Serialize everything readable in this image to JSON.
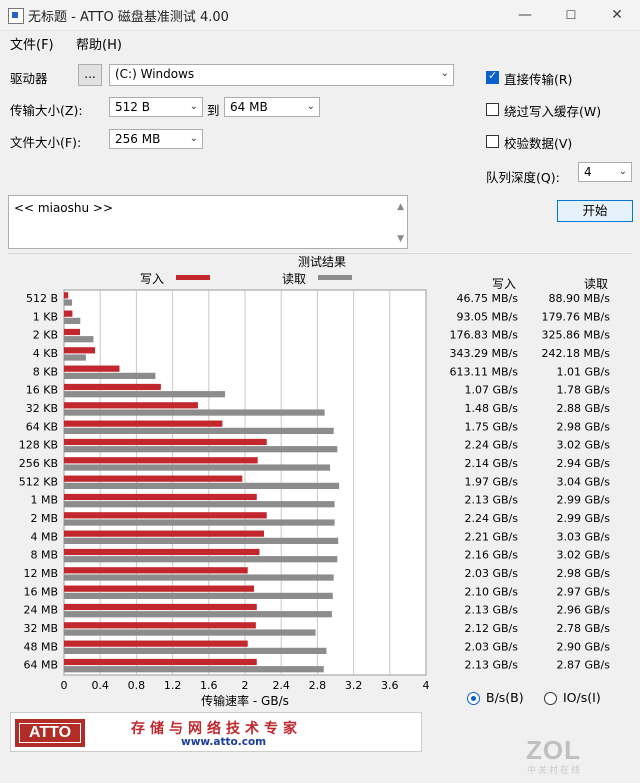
{
  "window": {
    "title": "无标题 - ATTO 磁盘基准测试 4.00",
    "minimize": "—",
    "maximize": "☐",
    "close": "✕"
  },
  "menu": {
    "file": "文件(F)",
    "help": "帮助(H)"
  },
  "settings": {
    "drive_label": "驱动器",
    "browse_label": "...",
    "drive_value": "(C:) Windows",
    "transfer_size_label": "传输大小(Z):",
    "transfer_from": "512 B",
    "to_label": "到",
    "transfer_to": "64 MB",
    "file_size_label": "文件大小(F):",
    "file_size": "256 MB",
    "direct_io_label": "直接传输(R)",
    "direct_io_checked": true,
    "bypass_cache_label": "绕过写入缓存(W)",
    "bypass_cache_checked": false,
    "verify_label": "校验数据(V)",
    "verify_checked": false,
    "queue_depth_label": "队列深度(Q):",
    "queue_depth": "4",
    "start_label": "开始",
    "description": "<< miaoshu >>"
  },
  "results": {
    "title": "测试结果",
    "legend_write": "写入",
    "legend_read": "读取",
    "col_write": "写入",
    "col_read": "读取",
    "unit_bytes_label": "B/s(B)",
    "unit_io_label": "IO/s(I)",
    "unit_selected": "bytes",
    "write_color": "#c2272d",
    "read_color": "#8c8c8c"
  },
  "chart_data": {
    "type": "bar",
    "orientation": "horizontal",
    "title": "测试结果",
    "xlabel": "传输速率 - GB/s",
    "xlim": [
      0,
      4
    ],
    "xticks": [
      "0",
      "0.4",
      "0.8",
      "1.2",
      "1.6",
      "2",
      "2.4",
      "2.8",
      "3.2",
      "3.6",
      "4"
    ],
    "grid": true,
    "legend_placement": "top",
    "categories": [
      "512 B",
      "1 KB",
      "2 KB",
      "4 KB",
      "8 KB",
      "16 KB",
      "32 KB",
      "64 KB",
      "128 KB",
      "256 KB",
      "512 KB",
      "1 MB",
      "2 MB",
      "4 MB",
      "8 MB",
      "12 MB",
      "16 MB",
      "24 MB",
      "32 MB",
      "48 MB",
      "64 MB"
    ],
    "series": [
      {
        "name": "写入",
        "values": [
          0.04675,
          0.09305,
          0.17683,
          0.34329,
          0.61311,
          1.07,
          1.48,
          1.75,
          2.24,
          2.14,
          1.97,
          2.13,
          2.24,
          2.21,
          2.16,
          2.03,
          2.1,
          2.13,
          2.12,
          2.03,
          2.13
        ]
      },
      {
        "name": "读取",
        "values": [
          0.0889,
          0.17976,
          0.32586,
          0.24218,
          1.01,
          1.78,
          2.88,
          2.98,
          3.02,
          2.94,
          3.04,
          2.99,
          2.99,
          3.03,
          3.02,
          2.98,
          2.97,
          2.96,
          2.78,
          2.9,
          2.87
        ]
      }
    ],
    "write_labels": [
      "46.75 MB/s",
      "93.05 MB/s",
      "176.83 MB/s",
      "343.29 MB/s",
      "613.11 MB/s",
      "1.07 GB/s",
      "1.48 GB/s",
      "1.75 GB/s",
      "2.24 GB/s",
      "2.14 GB/s",
      "1.97 GB/s",
      "2.13 GB/s",
      "2.24 GB/s",
      "2.21 GB/s",
      "2.16 GB/s",
      "2.03 GB/s",
      "2.10 GB/s",
      "2.13 GB/s",
      "2.12 GB/s",
      "2.03 GB/s",
      "2.13 GB/s"
    ],
    "read_labels": [
      "88.90 MB/s",
      "179.76 MB/s",
      "325.86 MB/s",
      "242.18 MB/s",
      "1.01 GB/s",
      "1.78 GB/s",
      "2.88 GB/s",
      "2.98 GB/s",
      "3.02 GB/s",
      "2.94 GB/s",
      "3.04 GB/s",
      "2.99 GB/s",
      "2.99 GB/s",
      "3.03 GB/s",
      "3.02 GB/s",
      "2.98 GB/s",
      "2.97 GB/s",
      "2.96 GB/s",
      "2.78 GB/s",
      "2.90 GB/s",
      "2.87 GB/s"
    ]
  },
  "banner": {
    "logo_text": "ATTO",
    "slogan": "存储与网络技术专家",
    "url": "www.atto.com"
  },
  "watermark": {
    "brand": "ZOL",
    "sub": "中关村在线"
  }
}
